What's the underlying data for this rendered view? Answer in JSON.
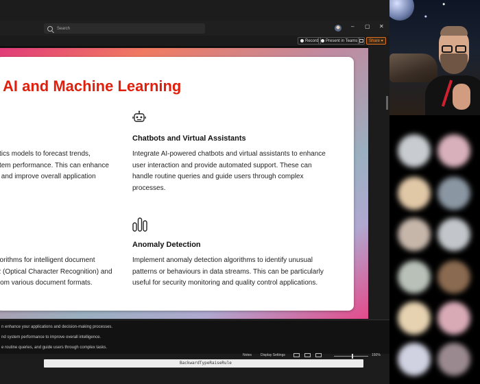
{
  "app": {
    "search_placeholder": "Search",
    "window_controls": {
      "minimize": "–",
      "maximize": "▢",
      "close": "✕"
    }
  },
  "toolbar": {
    "record_label": "Record",
    "present_label": "Present in Teams",
    "share_label": "Share ▾"
  },
  "slide": {
    "title": "AI and Machine Learning",
    "left_col_top": [
      "ytics models to forecast trends,",
      "stem performance. This can enhance",
      "s and improve overall application"
    ],
    "left_col_bottom": [
      "gorithms for intelligent document",
      "R (Optical Character Recognition) and",
      "from various document formats."
    ],
    "chatbots": {
      "icon": "robot-icon",
      "heading": "Chatbots and Virtual Assistants",
      "lines": [
        "Integrate AI-powered chatbots and virtual assistants to enhance",
        "user interaction and provide automated support. These can",
        "handle routine queries and guide users through complex",
        "processes."
      ]
    },
    "anomaly": {
      "icon": "bar-chart-icon",
      "heading": "Anomaly Detection",
      "lines": [
        "Implement anomaly detection algorithms to identify unusual",
        "patterns or behaviours in data streams. This can be particularly",
        "useful for security monitoring and quality control applications."
      ]
    }
  },
  "notes": {
    "lines": [
      "n enhance your applications and decision-making processes.",
      "nd system performance to improve overall intelligence.",
      "e routine queries, and guide users through complex tasks."
    ]
  },
  "statusbar": {
    "notes_label": "Notes",
    "display_settings_label": "Display Settings",
    "zoom": "150%"
  },
  "editor": {
    "text": "BackwardTypeRaiseRule"
  },
  "colors": {
    "title_red": "#e0200c",
    "share_orange": "#ff8c30"
  }
}
